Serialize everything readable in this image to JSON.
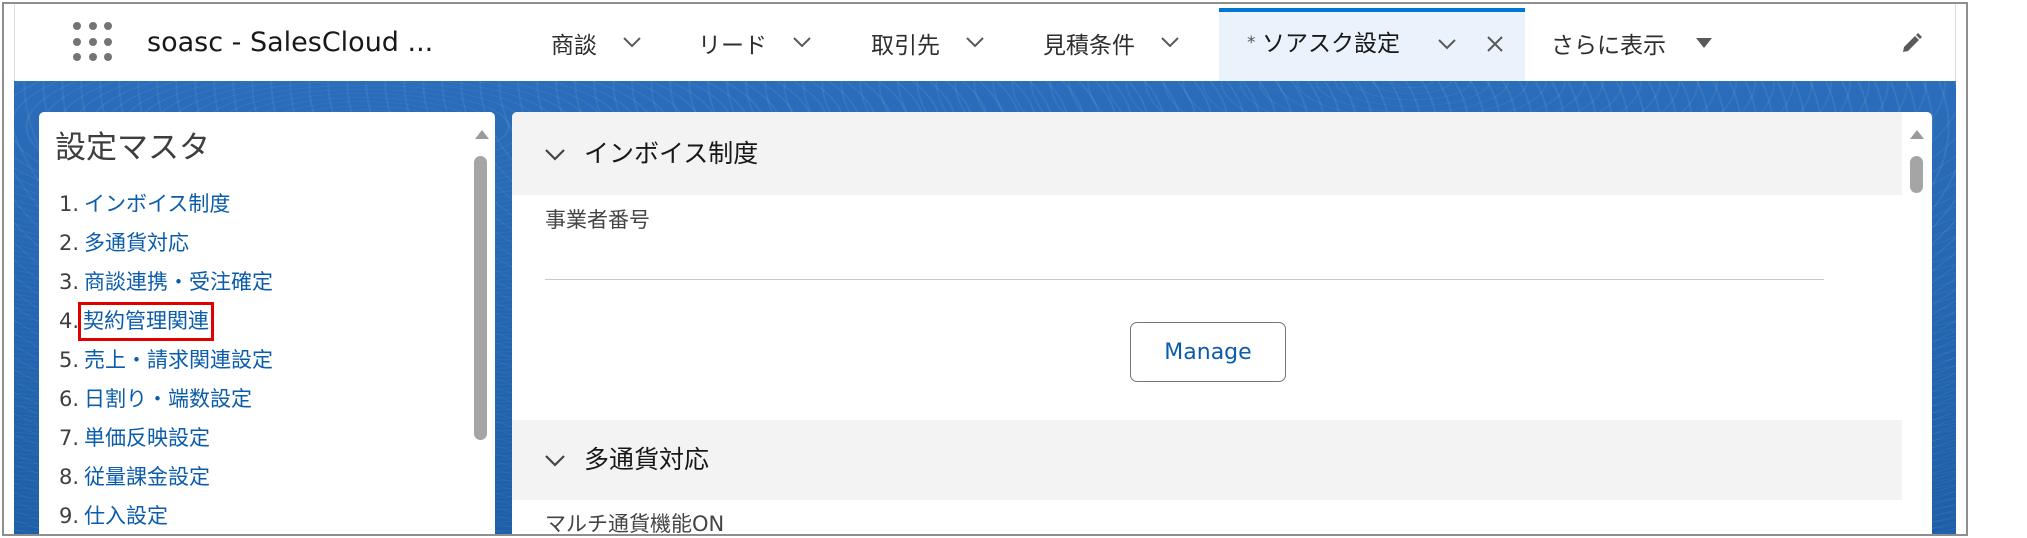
{
  "top_nav": {
    "app_name": "soasc - SalesCloud ...",
    "tabs": [
      {
        "label": "商談"
      },
      {
        "label": "リード"
      },
      {
        "label": "取引先"
      },
      {
        "label": "見積条件"
      }
    ],
    "active_tab": {
      "unsaved_marker": "*",
      "label": "ソアスク設定"
    },
    "more_tab": {
      "label": "さらに表示"
    },
    "icons": {
      "launcher": "app-launcher-icon",
      "tab_menu": "chevron-down-icon",
      "close": "close-icon",
      "more": "caret-down-icon",
      "edit": "pencil-icon"
    }
  },
  "sidebar": {
    "title": "設定マスタ",
    "items": [
      {
        "number": "1.",
        "label": "インボイス制度"
      },
      {
        "number": "2.",
        "label": "多通貨対応"
      },
      {
        "number": "3.",
        "label": "商談連携・受注確定"
      },
      {
        "number": "4.",
        "label": "契約管理関連",
        "highlighted": true
      },
      {
        "number": "5.",
        "label": "売上・請求関連設定"
      },
      {
        "number": "6.",
        "label": "日割り・端数設定"
      },
      {
        "number": "7.",
        "label": "単価反映設定"
      },
      {
        "number": "8.",
        "label": "従量課金設定"
      },
      {
        "number": "9.",
        "label": "仕入設定"
      }
    ]
  },
  "main": {
    "sections": [
      {
        "title": "インボイス制度",
        "field_label": "事業者番号",
        "button_label": "Manage"
      },
      {
        "title": "多通貨対応",
        "field_label": "マルチ通貨機能ON"
      }
    ]
  },
  "colors": {
    "brand_blue": "#0176d3",
    "link_blue": "#0b5cab",
    "highlight_red": "#e00000",
    "workspace_blue": "#1f63ad",
    "section_header_gray": "#f3f3f3"
  }
}
